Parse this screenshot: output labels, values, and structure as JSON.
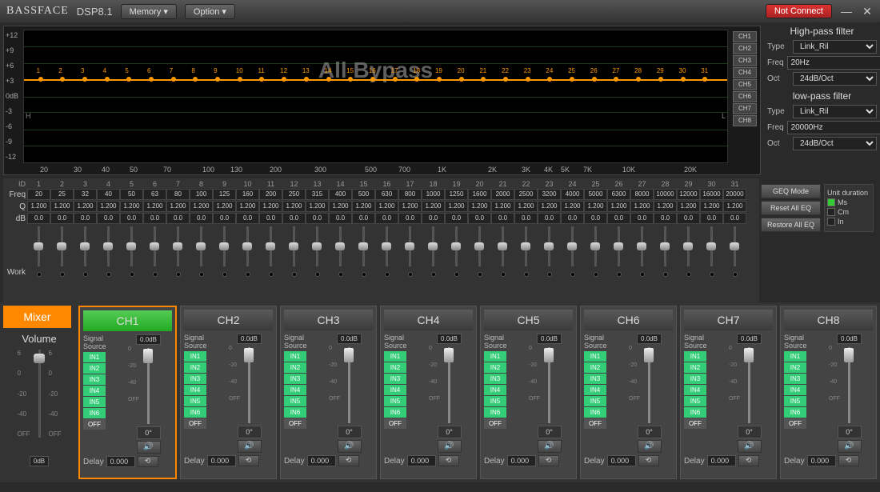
{
  "title": {
    "brand": "BASSFACE",
    "model": "DSP8.1"
  },
  "toolbar": {
    "memory": "Memory ▾",
    "option": "Option ▾",
    "status": "Not Connect"
  },
  "graph": {
    "watermark": "All Bypass",
    "ylabels": [
      "+12",
      "+9",
      "+6",
      "+3",
      "0dB",
      "-3",
      "-6",
      "-9",
      "-12"
    ],
    "xlabels": [
      "20",
      "30",
      "40",
      "50",
      "70",
      "100",
      "130",
      "200",
      "300",
      "500",
      "700",
      "1K",
      "2K",
      "3K",
      "4K",
      "5K",
      "7K",
      "10K",
      "20K"
    ],
    "channels": [
      "CH1",
      "CH2",
      "CH3",
      "CH4",
      "CH5",
      "CH6",
      "CH7",
      "CH8"
    ],
    "hmark": "H",
    "lmark": "L"
  },
  "filters": {
    "hp": {
      "title": "High-pass filter",
      "type_lbl": "Type",
      "type": "Link_Ril",
      "freq_lbl": "Freq",
      "freq": "20Hz",
      "oct_lbl": "Oct",
      "oct": "24dB/Oct"
    },
    "lp": {
      "title": "low-pass filter",
      "type_lbl": "Type",
      "type": "Link_Ril",
      "freq_lbl": "Freq",
      "freq": "20000Hz",
      "oct_lbl": "Oct",
      "oct": "24dB/Oct"
    }
  },
  "eq": {
    "labels": {
      "id": "ID",
      "freq": "Freq",
      "q": "Q",
      "db": "dB",
      "work": "Work"
    },
    "ids": [
      "1",
      "2",
      "3",
      "4",
      "5",
      "6",
      "7",
      "8",
      "9",
      "10",
      "11",
      "12",
      "13",
      "14",
      "15",
      "16",
      "17",
      "18",
      "19",
      "20",
      "21",
      "22",
      "23",
      "24",
      "25",
      "26",
      "27",
      "28",
      "29",
      "30",
      "31"
    ],
    "freq": [
      "20",
      "25",
      "32",
      "40",
      "50",
      "63",
      "80",
      "100",
      "125",
      "160",
      "200",
      "250",
      "315",
      "400",
      "500",
      "630",
      "800",
      "1000",
      "1250",
      "1600",
      "2000",
      "2500",
      "3200",
      "4000",
      "5000",
      "6300",
      "8000",
      "10000",
      "12000",
      "16000",
      "20000"
    ],
    "q": [
      "1.200",
      "1.200",
      "1.200",
      "1.200",
      "1.200",
      "1.200",
      "1.200",
      "1.200",
      "1.200",
      "1.200",
      "1.200",
      "1.200",
      "1.200",
      "1.200",
      "1.200",
      "1.200",
      "1.200",
      "1.200",
      "1.200",
      "1.200",
      "1.200",
      "1.200",
      "1.200",
      "1.200",
      "1.200",
      "1.200",
      "1.200",
      "1.200",
      "1.200",
      "1.200",
      "1.200"
    ],
    "db": [
      "0.0",
      "0.0",
      "0.0",
      "0.0",
      "0.0",
      "0.0",
      "0.0",
      "0.0",
      "0.0",
      "0.0",
      "0.0",
      "0.0",
      "0.0",
      "0.0",
      "0.0",
      "0.0",
      "0.0",
      "0.0",
      "0.0",
      "0.0",
      "0.0",
      "0.0",
      "0.0",
      "0.0",
      "0.0",
      "0.0",
      "0.0",
      "0.0",
      "0.0",
      "0.0",
      "0.0"
    ],
    "buttons": {
      "geq": "GEQ Mode",
      "reset": "Reset All EQ",
      "restore": "Restore All EQ"
    },
    "unit": {
      "title": "Unit duration",
      "ms": "Ms",
      "cm": "Cm",
      "in": "In"
    }
  },
  "mixer": {
    "btn": "Mixer",
    "volume": "Volume",
    "scale": [
      "6",
      "0",
      "-20",
      "-40",
      "OFF"
    ],
    "badge": "0dB"
  },
  "channels": [
    {
      "name": "CH1",
      "active": true
    },
    {
      "name": "CH2"
    },
    {
      "name": "CH3"
    },
    {
      "name": "CH4"
    },
    {
      "name": "CH5"
    },
    {
      "name": "CH6"
    },
    {
      "name": "CH7"
    },
    {
      "name": "CH8"
    }
  ],
  "ch_common": {
    "signal": "Signal Source",
    "db": "0.0dB",
    "inputs": [
      "IN1",
      "IN2",
      "IN3",
      "IN4",
      "IN5",
      "IN6"
    ],
    "off": "OFF",
    "phase": "0°",
    "delay_lbl": "Delay",
    "delay": "0.000",
    "fscale": [
      "0",
      "-20",
      "-40",
      "OFF"
    ],
    "speaker": "🔊",
    "link": "⟲"
  }
}
